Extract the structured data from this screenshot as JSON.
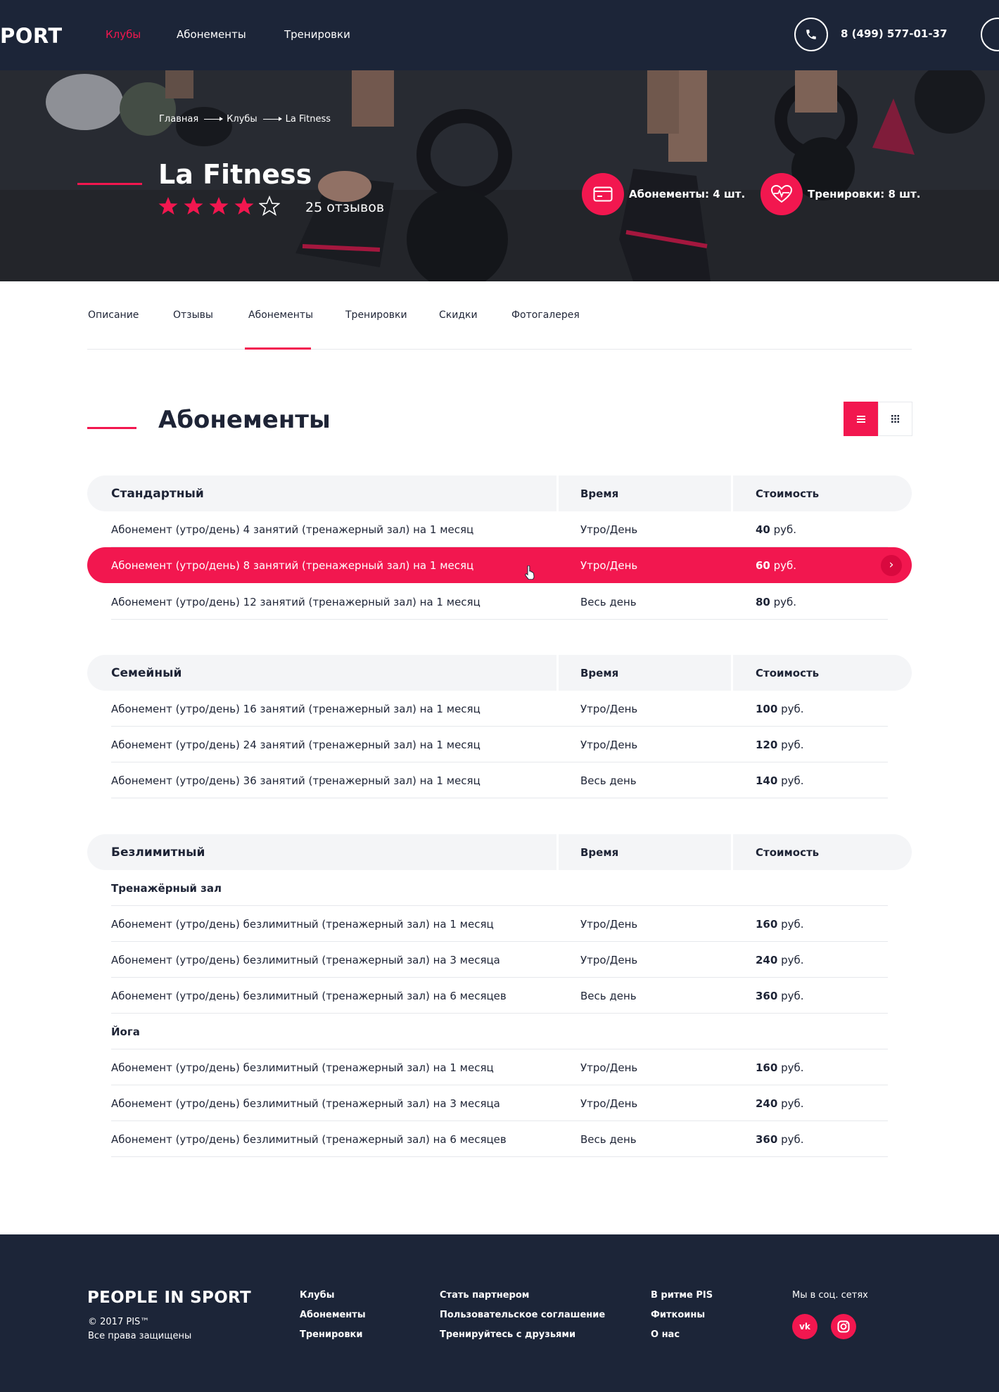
{
  "header": {
    "logo": "PORT",
    "nav": [
      {
        "label": "Клубы",
        "active": true
      },
      {
        "label": "Абонементы",
        "active": false
      },
      {
        "label": "Тренировки",
        "active": false
      }
    ],
    "phone_icon": "phone-icon",
    "phone": "8 (499) 577-01-37",
    "user_icon": "user-icon"
  },
  "hero": {
    "breadcrumb": [
      "Главная",
      "Клубы",
      "La Fitness"
    ],
    "title": "La Fitness",
    "rating": 4,
    "rating_max": 5,
    "reviews": "25 отзывов",
    "stats": [
      {
        "icon": "card-icon",
        "label": "Абонементы: 4 шт."
      },
      {
        "icon": "heart-pulse-icon",
        "label": "Тренировки: 8 шт."
      }
    ]
  },
  "tabs": [
    "Описание",
    "Отзывы",
    "Абонементы",
    "Тренировки",
    "Скидки",
    "Фотогалерея"
  ],
  "active_tab": 2,
  "section": {
    "title": "Абонементы",
    "view_modes": [
      "list-icon",
      "grid-icon"
    ],
    "active_view": 0
  },
  "columns": {
    "time": "Время",
    "price": "Стоимость"
  },
  "currency": "руб.",
  "groups": [
    {
      "name": "Стандартный",
      "rows": [
        {
          "name": "Абонемент (утро/день) 4 занятий (тренажерный зал) на 1 месяц",
          "time": "Утро/День",
          "price": "40"
        },
        {
          "name": "Абонемент (утро/день) 8 занятий (тренажерный зал) на 1 месяц",
          "time": "Утро/День",
          "price": "60",
          "highlight": true
        },
        {
          "name": "Абонемент (утро/день) 12 занятий (тренажерный зал) на 1 месяц",
          "time": "Весь день",
          "price": "80"
        }
      ]
    },
    {
      "name": "Семейный",
      "rows": [
        {
          "name": "Абонемент (утро/день) 16 занятий (тренажерный зал) на 1 месяц",
          "time": "Утро/День",
          "price": "100"
        },
        {
          "name": "Абонемент (утро/день) 24 занятий (тренажерный зал) на 1 месяц",
          "time": "Утро/День",
          "price": "120"
        },
        {
          "name": "Абонемент (утро/день) 36 занятий (тренажерный зал) на 1 месяц",
          "time": "Весь день",
          "price": "140"
        }
      ]
    },
    {
      "name": "Безлимитный",
      "subgroups": [
        {
          "name": "Тренажёрный зал",
          "rows": [
            {
              "name": "Абонемент (утро/день) безлимитный (тренажерный зал) на 1 месяц",
              "time": "Утро/День",
              "price": "160"
            },
            {
              "name": "Абонемент (утро/день) безлимитный (тренажерный зал) на 3 месяца",
              "time": "Утро/День",
              "price": "240"
            },
            {
              "name": "Абонемент (утро/день) безлимитный (тренажерный зал) на 6 месяцев",
              "time": "Весь день",
              "price": "360"
            }
          ]
        },
        {
          "name": "Йога",
          "rows": [
            {
              "name": "Абонемент (утро/день) безлимитный (тренажерный зал) на 1 месяц",
              "time": "Утро/День",
              "price": "160"
            },
            {
              "name": "Абонемент (утро/день) безлимитный (тренажерный зал) на 3 месяца",
              "time": "Утро/День",
              "price": "240"
            },
            {
              "name": "Абонемент (утро/день) безлимитный (тренажерный зал) на 6 месяцев",
              "time": "Весь день",
              "price": "360"
            }
          ]
        }
      ]
    }
  ],
  "footer": {
    "brand": "PEOPLE IN SPORT",
    "copyright": "© 2017 PIS™",
    "rights": "Все права защищены",
    "col1": [
      "Клубы",
      "Абонементы",
      "Тренировки"
    ],
    "col2": [
      "Стать партнером",
      "Пользовательское соглашение",
      "Тренируйтесь с друзьями"
    ],
    "col3": [
      "В ритме PIS",
      "Фиткоины",
      "О нас"
    ],
    "social_label": "Мы в соц. сетях",
    "social": [
      {
        "icon": "vk-icon",
        "text": "vk"
      },
      {
        "icon": "instagram-icon",
        "text": ""
      }
    ]
  },
  "colors": {
    "accent": "#f2174f",
    "dark": "#1c2538",
    "text": "#1e2436",
    "muted_bg": "#f4f5f7"
  }
}
